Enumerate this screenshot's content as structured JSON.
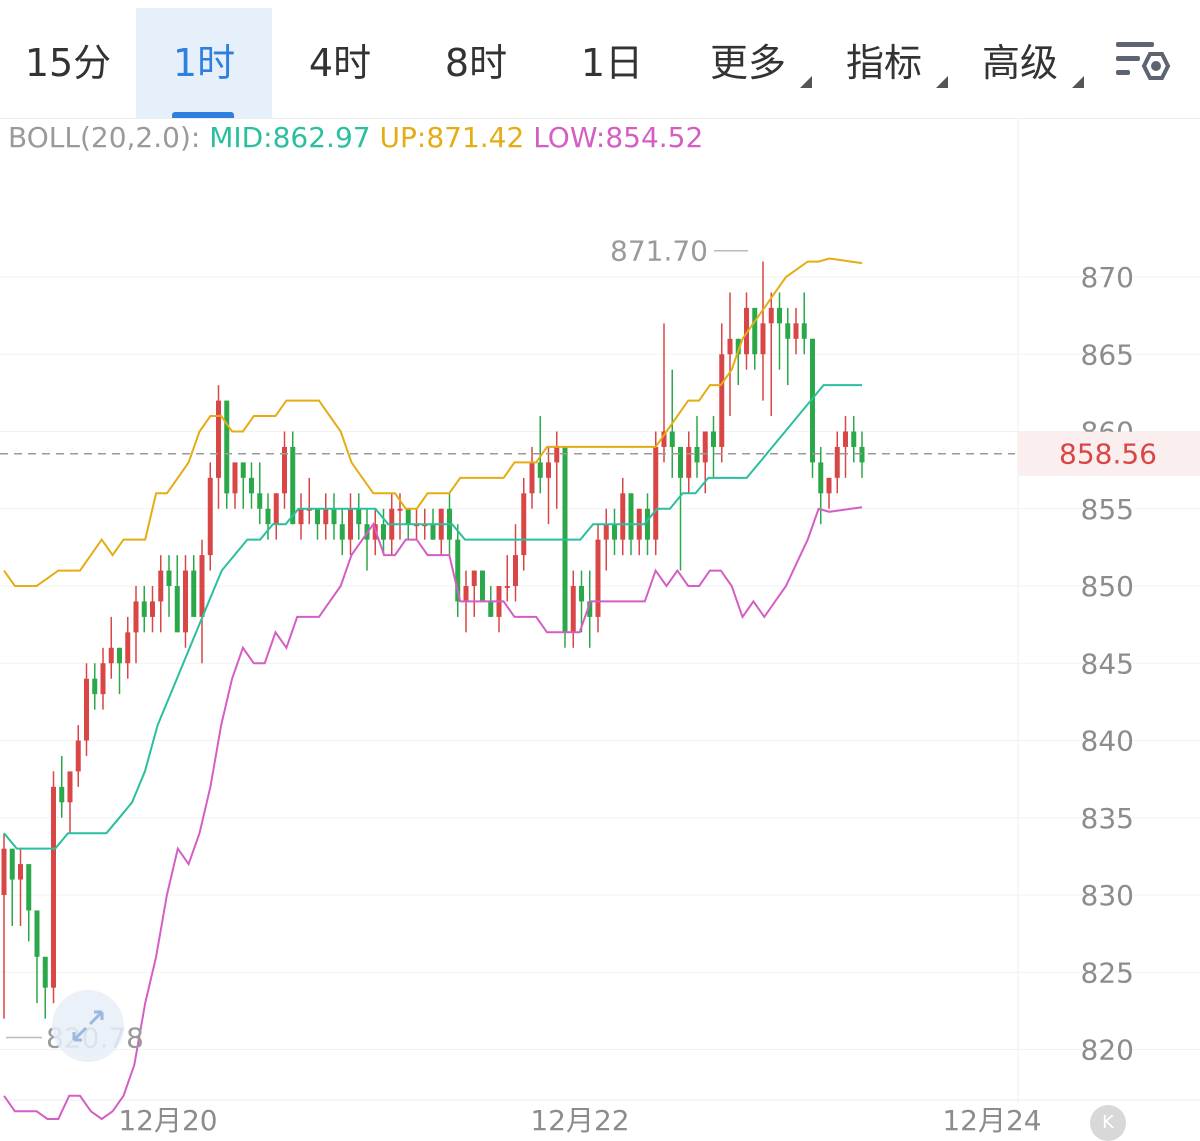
{
  "tabs": [
    {
      "label": "15分",
      "active": false,
      "dropdown": false
    },
    {
      "label": "1时",
      "active": true,
      "dropdown": false
    },
    {
      "label": "4时",
      "active": false,
      "dropdown": false
    },
    {
      "label": "8时",
      "active": false,
      "dropdown": false
    },
    {
      "label": "1日",
      "active": false,
      "dropdown": false
    },
    {
      "label": "更多",
      "active": false,
      "dropdown": true
    },
    {
      "label": "指标",
      "active": false,
      "dropdown": true
    },
    {
      "label": "高级",
      "active": false,
      "dropdown": true
    }
  ],
  "settings_icon": "chart-settings-icon",
  "indicator": {
    "name": "BOLL(20,2.0):",
    "mid": "MID:862.97",
    "up": "UP:871.42",
    "low": "LOW:854.52"
  },
  "colors": {
    "accent": "#2f7fe0",
    "up_candle": "#d94646",
    "down_candle": "#2aa84a",
    "mid_line": "#2abf9e",
    "upper_band": "#e4ad14",
    "lower_band": "#d45ec4",
    "current_price": "#d94646"
  },
  "chart_data": {
    "type": "candlestick",
    "y_ticks": [
      870,
      865,
      860,
      855,
      850,
      845,
      840,
      835,
      830,
      825,
      820
    ],
    "ylim": [
      815,
      875
    ],
    "x_labels": [
      "12月20",
      "12月22",
      "12月24"
    ],
    "current_price": "858.56",
    "high_annotation": "871.70",
    "low_annotation": "820.78",
    "candles": [
      [
        830,
        834,
        822,
        833
      ],
      [
        833,
        832,
        828,
        831
      ],
      [
        831,
        833,
        828,
        832
      ],
      [
        832,
        831,
        827,
        829
      ],
      [
        829,
        828,
        823,
        826
      ],
      [
        826,
        826,
        822,
        824
      ],
      [
        824,
        838,
        823,
        837
      ],
      [
        837,
        839,
        835,
        836
      ],
      [
        836,
        837,
        834,
        838
      ],
      [
        838,
        841,
        837,
        840
      ],
      [
        840,
        845,
        839,
        844
      ],
      [
        844,
        845,
        842,
        843
      ],
      [
        843,
        846,
        842,
        845
      ],
      [
        845,
        848,
        844,
        846
      ],
      [
        846,
        846,
        843,
        845
      ],
      [
        845,
        848,
        844,
        847
      ],
      [
        847,
        850,
        845,
        849
      ],
      [
        849,
        850,
        847,
        848
      ],
      [
        848,
        850,
        847,
        849
      ],
      [
        849,
        852,
        847,
        851
      ],
      [
        851,
        852,
        848,
        850
      ],
      [
        850,
        852,
        848,
        847
      ],
      [
        847,
        852,
        846,
        851
      ],
      [
        851,
        852,
        849,
        848
      ],
      [
        848,
        853,
        845,
        852
      ],
      [
        852,
        858,
        851,
        857
      ],
      [
        857,
        863,
        855,
        862
      ],
      [
        862,
        862,
        855,
        856
      ],
      [
        856,
        858,
        855,
        858
      ],
      [
        858,
        858,
        855,
        857
      ],
      [
        857,
        858,
        855,
        856
      ],
      [
        856,
        858,
        854,
        855
      ],
      [
        855,
        856,
        853,
        854
      ],
      [
        854,
        856,
        853,
        856
      ],
      [
        856,
        860,
        855,
        859
      ],
      [
        859,
        860,
        855,
        854
      ],
      [
        854,
        856,
        853,
        855
      ],
      [
        855,
        857,
        854,
        855
      ],
      [
        855,
        855,
        853,
        854
      ],
      [
        854,
        856,
        853,
        855
      ],
      [
        855,
        856,
        853,
        854
      ],
      [
        854,
        855,
        852,
        853
      ],
      [
        853,
        856,
        852,
        855
      ],
      [
        855,
        856,
        853,
        854
      ],
      [
        854,
        855,
        851,
        853
      ],
      [
        853,
        855,
        852,
        854
      ],
      [
        854,
        855,
        852,
        853
      ],
      [
        853,
        856,
        852,
        855
      ],
      [
        855,
        856,
        853,
        855
      ],
      [
        855,
        855,
        853,
        854
      ],
      [
        854,
        855,
        853,
        854
      ],
      [
        854,
        855,
        853,
        854
      ],
      [
        854,
        855,
        853,
        853
      ],
      [
        853,
        855,
        852,
        855
      ],
      [
        855,
        856,
        852,
        853
      ],
      [
        853,
        854,
        848,
        849
      ],
      [
        849,
        851,
        847,
        850
      ],
      [
        850,
        851,
        848,
        851
      ],
      [
        851,
        851,
        849,
        849
      ],
      [
        849,
        850,
        848,
        848
      ],
      [
        848,
        850,
        847,
        850
      ],
      [
        850,
        852,
        849,
        850
      ],
      [
        850,
        854,
        849,
        852
      ],
      [
        852,
        857,
        851,
        856
      ],
      [
        856,
        859,
        855,
        858
      ],
      [
        858,
        861,
        856,
        857
      ],
      [
        857,
        859,
        854,
        858
      ],
      [
        858,
        860,
        855,
        859
      ],
      [
        859,
        859,
        846,
        847
      ],
      [
        847,
        851,
        846,
        850
      ],
      [
        850,
        851,
        847,
        849
      ],
      [
        849,
        851,
        846,
        848
      ],
      [
        848,
        854,
        847,
        853
      ],
      [
        853,
        855,
        851,
        854
      ],
      [
        854,
        855,
        852,
        853
      ],
      [
        853,
        857,
        852,
        856
      ],
      [
        856,
        856,
        852,
        853
      ],
      [
        853,
        855,
        852,
        855
      ],
      [
        855,
        856,
        852,
        853
      ],
      [
        853,
        860,
        852,
        859
      ],
      [
        859,
        867,
        858,
        860
      ],
      [
        860,
        864,
        857,
        859
      ],
      [
        859,
        859,
        851,
        857
      ],
      [
        857,
        860,
        856,
        859
      ],
      [
        859,
        861,
        857,
        858
      ],
      [
        858,
        860,
        856,
        860
      ],
      [
        860,
        861,
        857,
        859
      ],
      [
        859,
        867,
        858,
        865
      ],
      [
        865,
        869,
        861,
        866
      ],
      [
        866,
        866,
        863,
        865
      ],
      [
        865,
        869,
        864,
        868
      ],
      [
        868,
        868,
        864,
        865
      ],
      [
        865,
        871,
        862,
        867
      ],
      [
        867,
        869,
        861,
        868
      ],
      [
        868,
        869,
        864,
        867
      ],
      [
        867,
        868,
        863,
        866
      ],
      [
        866,
        868,
        865,
        867
      ],
      [
        867,
        869,
        865,
        866
      ],
      [
        866,
        866,
        857,
        858
      ],
      [
        858,
        859,
        854,
        856
      ],
      [
        856,
        857,
        855,
        857
      ],
      [
        857,
        860,
        856,
        859
      ],
      [
        859,
        861,
        857,
        860
      ],
      [
        860,
        861,
        858,
        859
      ],
      [
        859,
        860,
        857,
        858
      ]
    ],
    "upper_band": [
      851,
      850,
      850,
      850,
      850.5,
      851,
      851,
      851,
      852,
      853,
      852,
      853,
      853,
      853,
      856,
      856,
      857,
      858,
      860,
      861,
      861,
      860,
      860,
      861,
      861,
      861,
      862,
      862,
      862,
      862,
      861,
      860,
      858,
      857,
      856,
      856,
      856,
      855,
      855,
      856,
      856,
      856,
      857,
      857,
      857,
      857,
      857,
      858,
      858,
      858,
      859,
      859,
      859,
      859,
      859,
      859,
      859,
      859,
      859,
      859,
      859,
      860,
      861,
      862,
      862,
      863,
      863,
      864,
      866,
      867,
      868,
      869,
      870,
      870.5,
      871,
      871,
      871.2,
      871.1,
      871.0,
      870.9
    ],
    "mid_band": [
      834,
      833,
      833,
      833,
      833,
      834,
      834,
      834,
      834,
      835,
      836,
      838,
      841,
      843,
      845,
      847,
      849,
      851,
      852,
      853,
      853,
      854,
      854,
      855,
      855,
      855,
      855,
      855,
      855,
      855,
      854,
      854,
      854,
      854,
      854,
      854,
      853,
      853,
      853,
      853,
      853,
      853,
      853,
      853,
      853,
      853,
      854,
      854,
      854,
      854,
      854,
      855,
      855,
      856,
      856,
      857,
      857,
      857,
      857,
      858,
      859,
      860,
      861,
      862,
      863,
      863,
      863,
      863
    ]
  }
}
